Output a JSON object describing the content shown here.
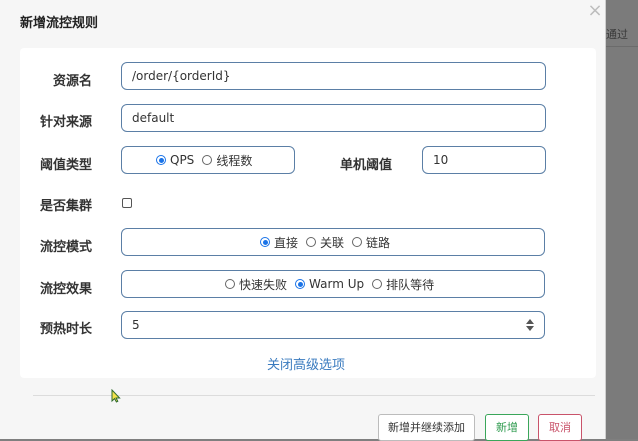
{
  "modal": {
    "title": "新增流控规则",
    "close_glyph": "×"
  },
  "background": {
    "right_text": "通过"
  },
  "form": {
    "resource": {
      "label": "资源名",
      "value": "/order/{orderId}"
    },
    "source": {
      "label": "针对来源",
      "value": "default"
    },
    "threshold_type": {
      "label": "阈值类型",
      "options": [
        "QPS",
        "线程数"
      ],
      "selected": "QPS"
    },
    "single_threshold": {
      "label": "单机阈值",
      "value": "10"
    },
    "cluster": {
      "label": "是否集群",
      "checked": false
    },
    "flow_mode": {
      "label": "流控模式",
      "options": [
        "直接",
        "关联",
        "链路"
      ],
      "selected": "直接"
    },
    "flow_effect": {
      "label": "流控效果",
      "options": [
        "快速失败",
        "Warm Up",
        "排队等待"
      ],
      "selected": "Warm Up"
    },
    "warmup": {
      "label": "预热时长",
      "value": "5"
    },
    "advanced_link": "关闭高级选项"
  },
  "footer": {
    "add_continue": "新增并继续添加",
    "add": "新增",
    "cancel": "取消"
  },
  "colors": {
    "input_border": "#5b7fa6",
    "radio_accent": "#1a73e8",
    "link": "#3a7bbf",
    "add_green": "#2f9b4f",
    "cancel_red": "#c9536a"
  }
}
